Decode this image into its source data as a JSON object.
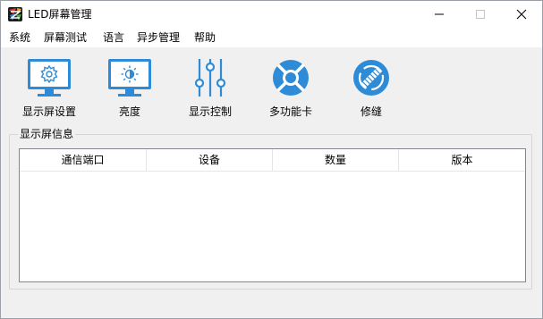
{
  "window": {
    "title": "LED屏幕管理"
  },
  "menu": [
    "系统",
    "屏幕测试",
    "语言",
    "异步管理",
    "帮助"
  ],
  "toolbar": {
    "items": [
      {
        "label": "显示屏设置",
        "icon": "monitor-gear-icon"
      },
      {
        "label": "亮度",
        "icon": "monitor-brightness-icon"
      },
      {
        "label": "显示控制",
        "icon": "sliders-icon"
      },
      {
        "label": "多功能卡",
        "icon": "lifebuoy-icon"
      },
      {
        "label": "修缝",
        "icon": "seam-repair-icon"
      }
    ]
  },
  "group": {
    "title": "显示屏信息",
    "columns": [
      "通信端口",
      "设备",
      "数量",
      "版本"
    ],
    "rows": []
  },
  "colors": {
    "accent": "#1f74c9",
    "monitor_screen": "#2e8bd8"
  }
}
